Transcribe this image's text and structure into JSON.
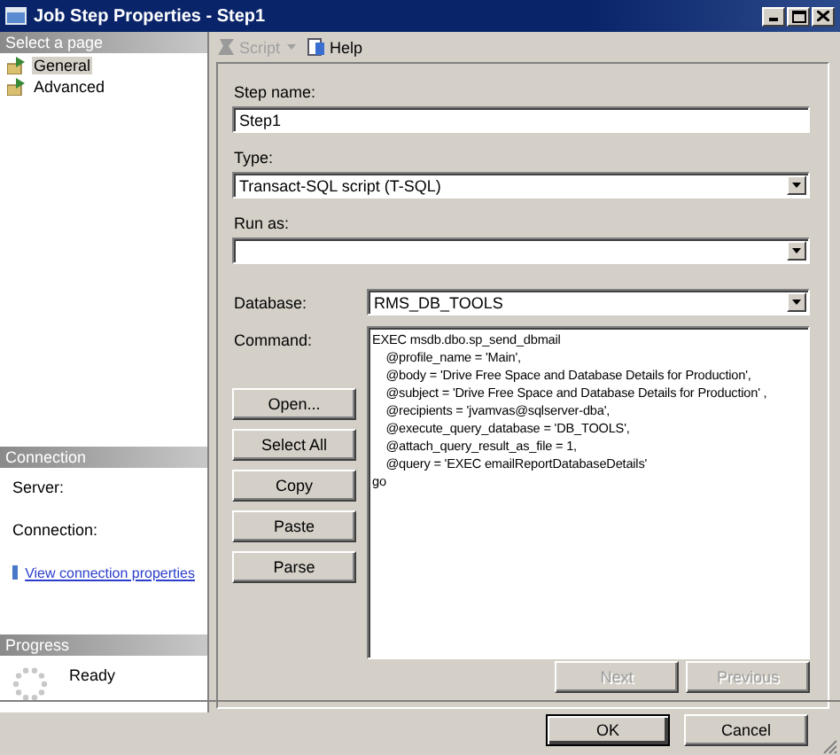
{
  "window": {
    "title": "Job Step Properties - Step1"
  },
  "sidebar": {
    "header": "Select a page",
    "items": [
      {
        "label": "General",
        "selected": true
      },
      {
        "label": "Advanced",
        "selected": false
      }
    ]
  },
  "connection": {
    "header": "Connection",
    "server_label": "Server:",
    "connection_label": "Connection:",
    "link": "View connection properties"
  },
  "progress": {
    "header": "Progress",
    "status": "Ready"
  },
  "toolbar": {
    "items": [
      {
        "label": "Script",
        "kind": "dropdown",
        "disabled": true
      },
      {
        "label": "Help",
        "kind": "button",
        "disabled": false
      }
    ]
  },
  "form": {
    "step_name": {
      "label": "Step name:",
      "value": "Step1"
    },
    "type": {
      "label": "Type:",
      "value": "Transact-SQL script (T-SQL)"
    },
    "run_as": {
      "label": "Run as:"
    },
    "database": {
      "label": "Database:",
      "value": "RMS_DB_TOOLS"
    },
    "command": {
      "label": "Command:",
      "lines": [
        "EXEC msdb.dbo.sp_send_dbmail",
        "    @profile_name = 'Main',",
        "    @body = 'Drive Free Space and Database Details for Production',",
        "    @subject = 'Drive Free Space and Database Details for Production' ,",
        "    @recipients = 'jvamvas@sqlserver-dba',",
        "    @execute_query_database = 'DB_TOOLS',",
        "    @attach_query_result_as_file = 1,",
        "    @query = 'EXEC emailReportDatabaseDetails'",
        "go"
      ]
    },
    "command_buttons": [
      "Open...",
      "Select All",
      "Copy",
      "Paste",
      "Parse"
    ],
    "nav_buttons": [
      {
        "label": "Next",
        "disabled": true
      },
      {
        "label": "Previous",
        "disabled": true
      }
    ]
  },
  "dialog_buttons": [
    {
      "label": "OK",
      "default": true
    },
    {
      "label": "Cancel",
      "default": false
    }
  ]
}
